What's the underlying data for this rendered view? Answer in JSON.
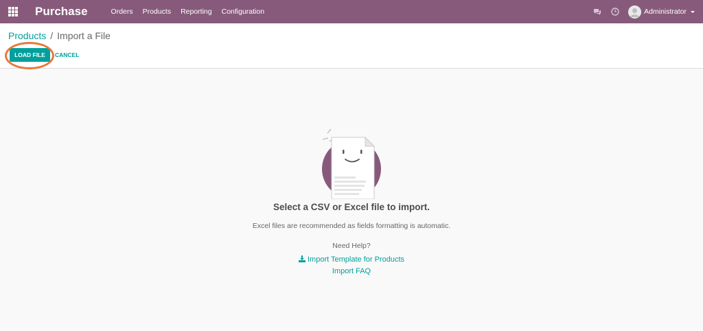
{
  "navbar": {
    "app_name": "Purchase",
    "menu": [
      "Orders",
      "Products",
      "Reporting",
      "Configuration"
    ],
    "user_name": "Administrator",
    "icons": [
      "apps-grid-icon",
      "chat-icon",
      "clock-icon",
      "avatar-icon",
      "caret-down-icon"
    ]
  },
  "breadcrumb": {
    "parent": "Products",
    "separator": "/",
    "current": "Import a File"
  },
  "actions": {
    "load_label": "LOAD FILE",
    "cancel_label": "CANCEL"
  },
  "content": {
    "title": "Select a CSV or Excel file to import.",
    "subtitle": "Excel files are recommended as fields formatting is automatic.",
    "help": "Need Help?",
    "template_link": "Import Template for Products",
    "faq_link": "Import FAQ"
  },
  "colors": {
    "brand": "#875a7b",
    "accent": "#00a09d",
    "highlight": "#e8783a"
  }
}
